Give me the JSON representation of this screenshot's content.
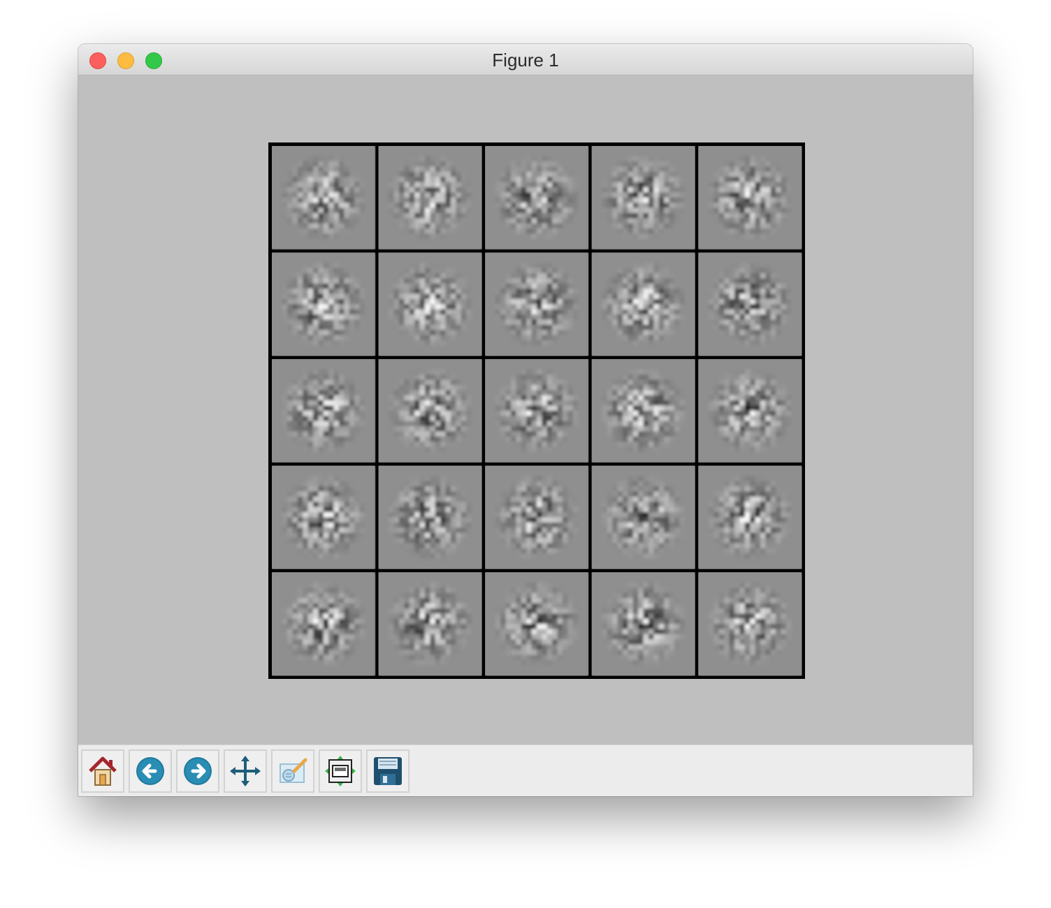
{
  "window": {
    "title": "Figure 1"
  },
  "figure": {
    "grid_rows": 5,
    "grid_cols": 5,
    "frame_color": "#000000",
    "tile_background": "#8f8f8f"
  },
  "toolbar": {
    "buttons": [
      {
        "name": "home",
        "icon": "home-icon"
      },
      {
        "name": "back",
        "icon": "back-arrow-icon"
      },
      {
        "name": "forward",
        "icon": "forward-arrow-icon"
      },
      {
        "name": "pan",
        "icon": "move-icon"
      },
      {
        "name": "zoom",
        "icon": "zoom-rect-icon"
      },
      {
        "name": "subplots",
        "icon": "configure-subplots-icon"
      },
      {
        "name": "save",
        "icon": "save-disk-icon"
      }
    ]
  }
}
